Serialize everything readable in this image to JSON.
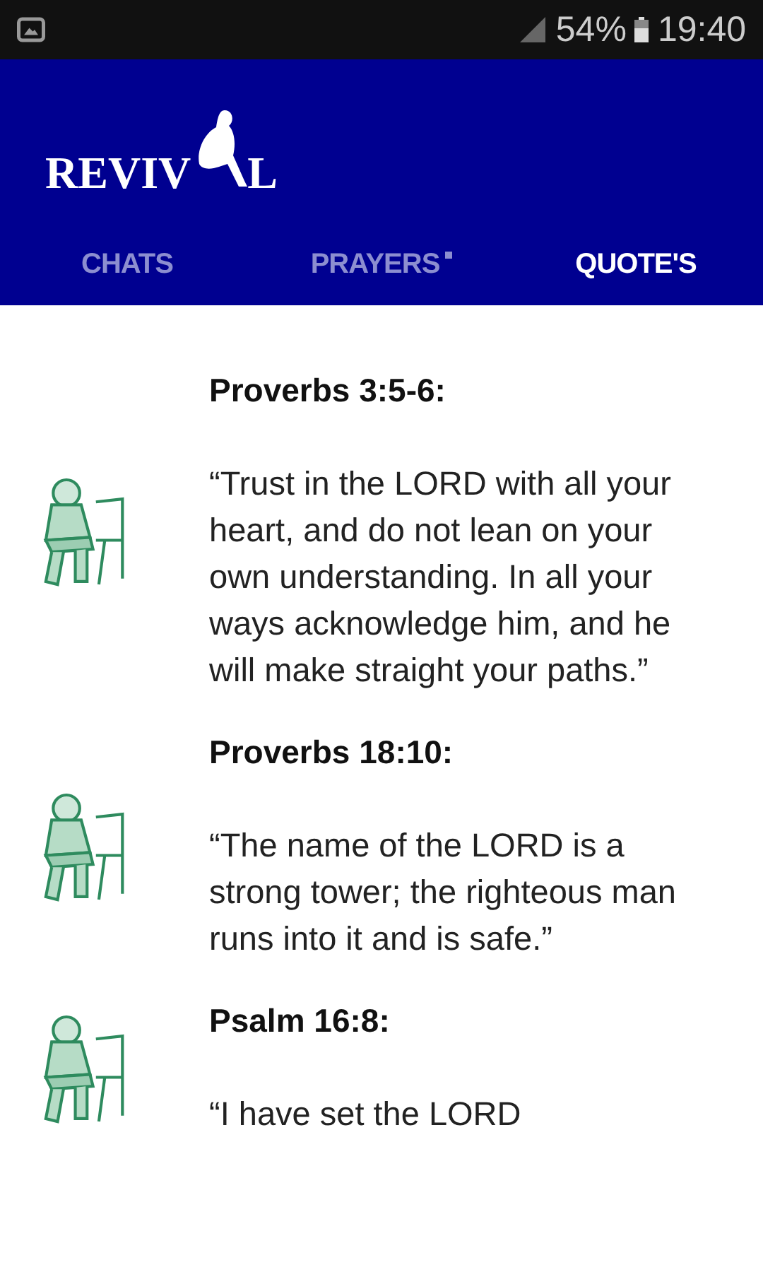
{
  "status_bar": {
    "battery": "54%",
    "time": "19:40"
  },
  "logo": {
    "left": "REVIV",
    "right": "L"
  },
  "tabs": [
    {
      "label": "CHATS",
      "selected": false,
      "badge": false
    },
    {
      "label": "PRAYERS",
      "selected": false,
      "badge": true
    },
    {
      "label": "QUOTE'S",
      "selected": true,
      "badge": false
    }
  ],
  "quotes": [
    {
      "reference": "Proverbs 3:5-6:",
      "text": "“Trust in the LORD with all your heart, and do not lean on your own understanding. In all your ways acknowledge him, and he will make straight your paths.”"
    },
    {
      "reference": "Proverbs 18:10:",
      "text": "“The name of the LORD is a strong tower; the righteous man runs into it and is safe.”"
    },
    {
      "reference": "Psalm 16:8:",
      "text": "“I have set the LORD"
    }
  ]
}
